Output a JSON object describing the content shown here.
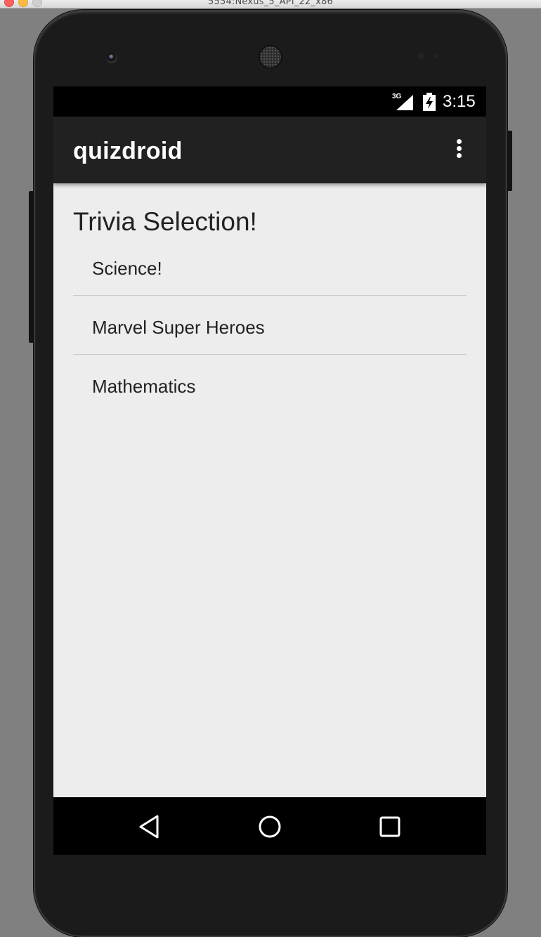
{
  "window": {
    "title": "5554:Nexus_5_API_22_x86"
  },
  "status_bar": {
    "network": "3G",
    "time": "3:15",
    "icons": [
      "signal-icon",
      "battery-charging-icon"
    ]
  },
  "app_bar": {
    "title": "quizdroid",
    "overflow_icon": "more-vert-icon"
  },
  "main": {
    "heading": "Trivia Selection!",
    "topics": [
      {
        "label": "Science!"
      },
      {
        "label": "Marvel Super Heroes"
      },
      {
        "label": "Mathematics"
      }
    ]
  },
  "nav_bar": {
    "icons": [
      "back-icon",
      "home-icon",
      "recents-icon"
    ]
  },
  "colors": {
    "app_bar": "#212121",
    "background": "#ededed",
    "text": "#222222"
  }
}
